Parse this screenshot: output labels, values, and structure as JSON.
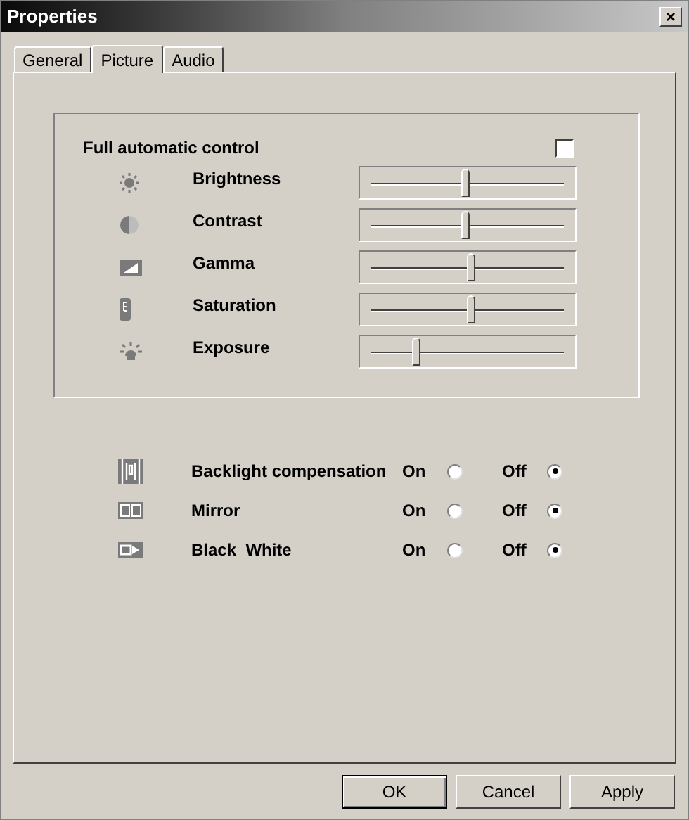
{
  "window": {
    "title": "Properties",
    "close": "×"
  },
  "tabs": [
    {
      "label": "General",
      "selected": false
    },
    {
      "label": "Picture",
      "selected": true
    },
    {
      "label": "Audio",
      "selected": false
    }
  ],
  "auto_control": {
    "label": "Full automatic control",
    "checked": false
  },
  "sliders": [
    {
      "kind": "brightness",
      "label": "Brightness",
      "level": 0.49
    },
    {
      "kind": "contrast",
      "label": "Contrast",
      "level": 0.49
    },
    {
      "kind": "gamma",
      "label": "Gamma",
      "level": 0.52
    },
    {
      "kind": "saturation",
      "label": "Saturation",
      "level": 0.52
    },
    {
      "kind": "exposure",
      "label": "Exposure",
      "level": 0.23
    }
  ],
  "options": [
    {
      "kind": "backlight",
      "label": "Backlight compensation",
      "choices": [
        {
          "label": "On",
          "selected": false
        },
        {
          "label": "Off",
          "selected": true
        }
      ]
    },
    {
      "kind": "mirror",
      "label": "Mirror",
      "choices": [
        {
          "label": "On",
          "selected": false
        },
        {
          "label": "Off",
          "selected": true
        }
      ]
    },
    {
      "kind": "blackwhite",
      "label": "Black  White",
      "choices": [
        {
          "label": "On",
          "selected": false
        },
        {
          "label": "Off",
          "selected": true
        }
      ]
    }
  ],
  "buttons": [
    {
      "label": "OK",
      "default": true
    },
    {
      "label": "Cancel",
      "default": false
    },
    {
      "label": "Apply",
      "default": false
    }
  ]
}
